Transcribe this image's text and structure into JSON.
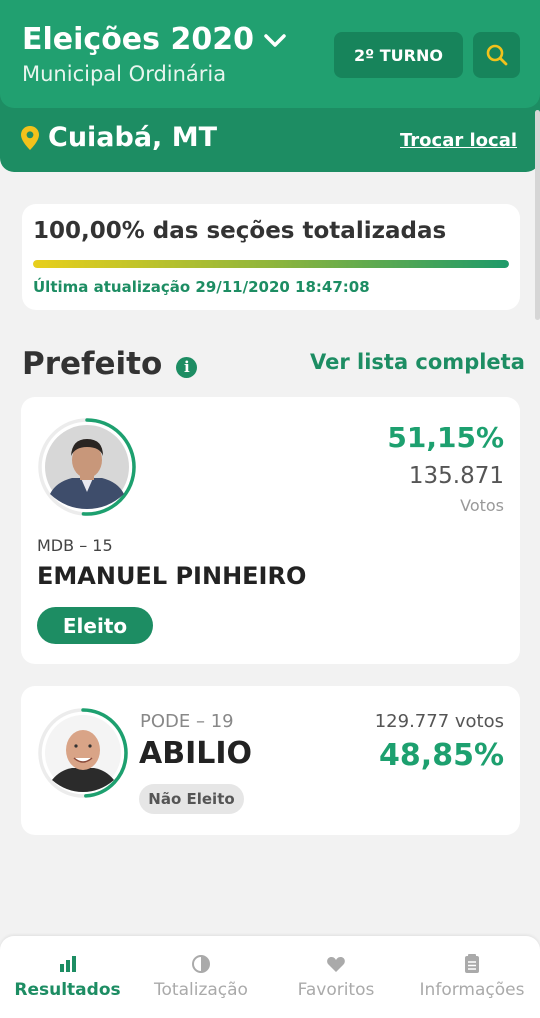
{
  "header": {
    "title": "Eleições 2020",
    "subtitle": "Municipal Ordinária",
    "turno_label": "2º TURNO",
    "location": "Cuiabá, MT",
    "change_location": "Trocar local"
  },
  "progress": {
    "title": "100,00% das seções totalizadas",
    "percent": 100,
    "last_update": "Última atualização 29/11/2020 18:47:08"
  },
  "section": {
    "title": "Prefeito",
    "info_icon": "i",
    "view_all": "Ver lista completa"
  },
  "candidates": [
    {
      "party": "MDB – 15",
      "name": "EMANUEL PINHEIRO",
      "percent": "51,15%",
      "percent_value": 51.15,
      "votes": "135.871",
      "votes_label": "Votos",
      "status": "Eleito"
    },
    {
      "party": "PODE – 19",
      "name": "ABILIO",
      "percent": "48,85%",
      "percent_value": 48.85,
      "votes": "129.777 votos",
      "status": "Não Eleito"
    }
  ],
  "nav": {
    "items": [
      {
        "label": "Resultados",
        "icon": "bar-chart-icon",
        "active": true
      },
      {
        "label": "Totalização",
        "icon": "pie-chart-icon",
        "active": false
      },
      {
        "label": "Favoritos",
        "icon": "heart-icon",
        "active": false
      },
      {
        "label": "Informações",
        "icon": "document-icon",
        "active": false
      }
    ]
  },
  "colors": {
    "primary": "#21a070",
    "primary_dark": "#1d8d63",
    "accent_yellow": "#f2c21b",
    "percent_green": "#1da06f"
  }
}
